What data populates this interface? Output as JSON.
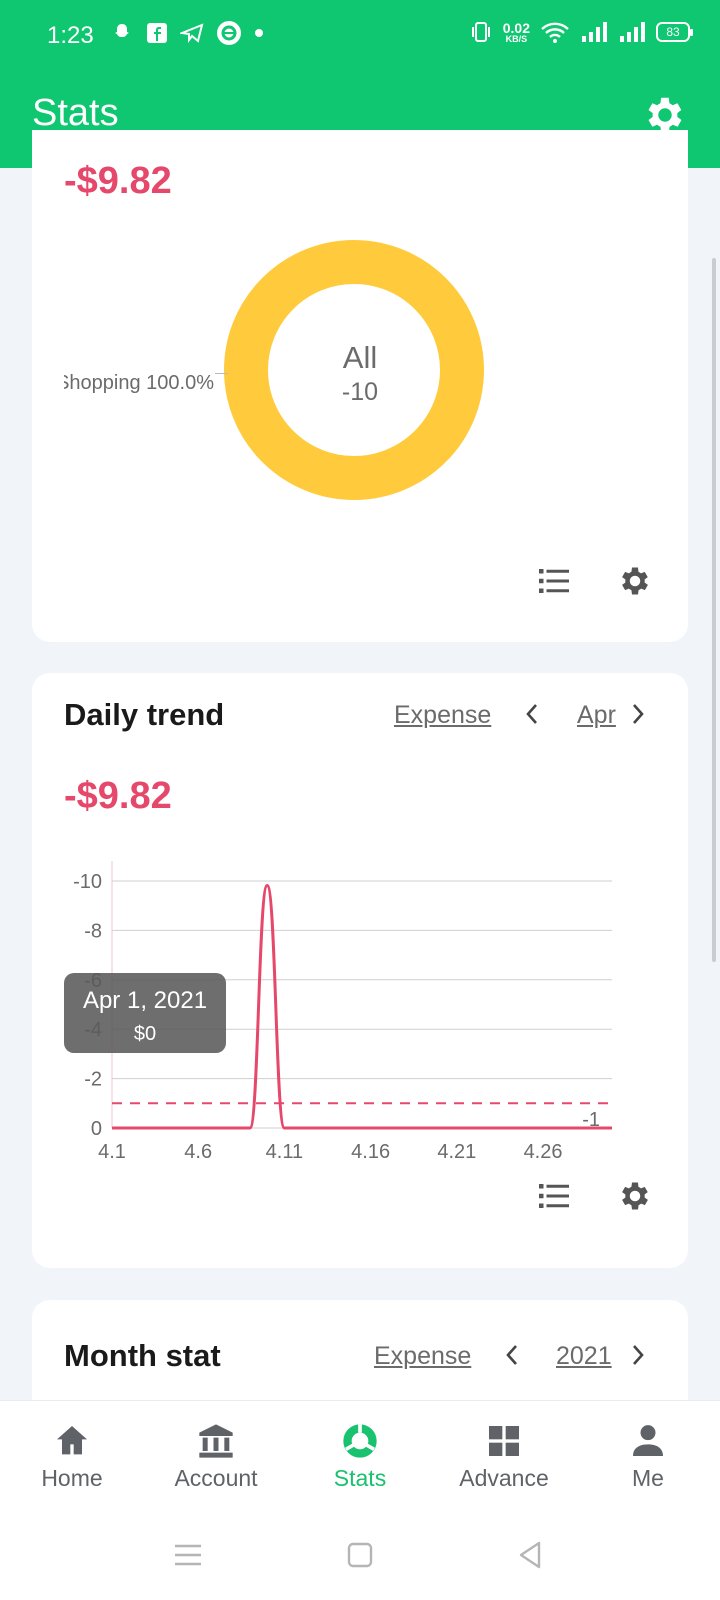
{
  "status": {
    "time": "1:23",
    "net_speed_value": "0.02",
    "net_speed_unit": "KB/S",
    "battery": "83",
    "left_icons": [
      "snapchat-icon",
      "facebook-icon",
      "telegram-icon",
      "messenger-icon",
      "dot-icon"
    ],
    "right_icons": [
      "vibrate-icon",
      "wifi-icon",
      "signal-icon",
      "signal-icon"
    ]
  },
  "app_bar": {
    "title": "Stats",
    "settings_icon": "gear-icon"
  },
  "category_card": {
    "amount": "-$9.82",
    "slice_label": "Shopping 100.0%",
    "center_title": "All",
    "center_value": "-10",
    "slice_color": "#ffcb3d"
  },
  "trend_card": {
    "title": "Daily trend",
    "type": "Expense",
    "period": "Apr",
    "amount": "-$9.82",
    "tooltip_date": "Apr 1, 2021",
    "tooltip_value": "$0"
  },
  "month_card": {
    "title": "Month stat",
    "type": "Expense",
    "period": "2021"
  },
  "nav": {
    "items": [
      {
        "label": "Home",
        "icon": "home-icon"
      },
      {
        "label": "Account",
        "icon": "bank-icon"
      },
      {
        "label": "Stats",
        "icon": "stats-icon"
      },
      {
        "label": "Advance",
        "icon": "grid-icon"
      },
      {
        "label": "Me",
        "icon": "person-icon"
      }
    ],
    "active": "Stats"
  },
  "colors": {
    "brand": "#0fc671",
    "expense": "#e5486a",
    "donut": "#ffcb3d",
    "muted": "#6b6b6b"
  },
  "chart_data": [
    {
      "type": "pie",
      "title": "",
      "slices": [
        {
          "label": "Shopping",
          "value": 100.0
        }
      ],
      "center_text": [
        "All",
        "-10"
      ]
    },
    {
      "type": "line",
      "title": "Daily trend",
      "xlabel": "",
      "ylabel": "",
      "x_ticks": [
        "4.1",
        "4.6",
        "4.11",
        "4.16",
        "4.21",
        "4.26"
      ],
      "y_ticks": [
        "-10",
        "-8",
        "-6",
        "-4",
        "-2",
        "0"
      ],
      "ylim": [
        0,
        -10
      ],
      "xlim": [
        1,
        30
      ],
      "series": [
        {
          "x": [
            1,
            2,
            3,
            4,
            5,
            6,
            7,
            8,
            9,
            10,
            11,
            12,
            13,
            14,
            15,
            16,
            17,
            18,
            19,
            20,
            21,
            22,
            23,
            24,
            25,
            26,
            27,
            28,
            29,
            30
          ],
          "values": [
            0,
            0,
            0,
            0,
            0,
            0,
            0,
            0,
            0,
            -9.82,
            0,
            0,
            0,
            0,
            0,
            0,
            0,
            0,
            0,
            0,
            0,
            0,
            0,
            0,
            0,
            0,
            0,
            0,
            0,
            0
          ]
        }
      ],
      "reference_line": {
        "value": -1,
        "label": "-1",
        "style": "dashed"
      },
      "grid": true
    }
  ]
}
